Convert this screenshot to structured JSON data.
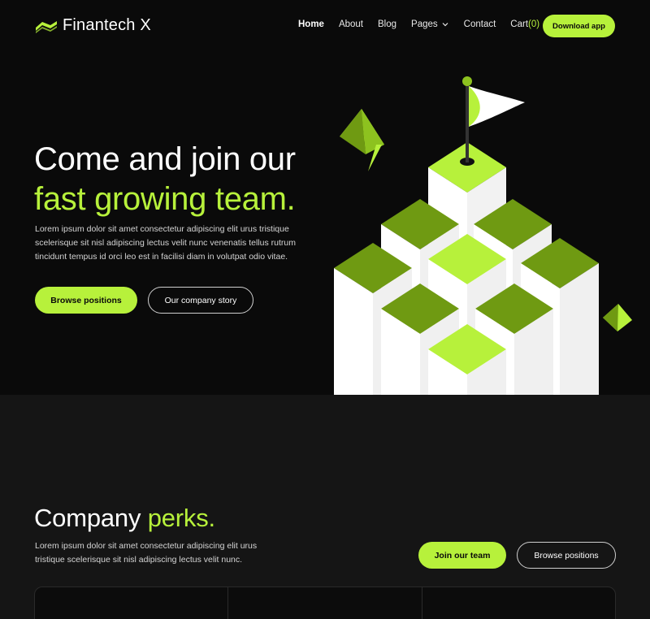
{
  "brand": {
    "name": "Finantech X",
    "accent_color": "#b7f13b",
    "dark_green": "#6f9a12",
    "background": "#0a0a0a"
  },
  "nav": {
    "items": [
      {
        "label": "Home",
        "active": true
      },
      {
        "label": "About"
      },
      {
        "label": "Blog"
      },
      {
        "label": "Pages",
        "has_dropdown": true
      },
      {
        "label": "Contact"
      }
    ],
    "cart_label": "Cart",
    "cart_count": "(0)",
    "download_label": "Download app"
  },
  "hero": {
    "title_line1": "Come and join our",
    "title_line2": "fast growing team.",
    "description": "Lorem ipsum dolor sit amet consectetur adipiscing elit urus tristique scelerisque sit nisl adipiscing lectus velit nunc venenatis tellus rutrum tincidunt tempus id orci leo est in facilisi diam in volutpat odio vitae.",
    "primary_button": "Browse positions",
    "secondary_button": "Our company story",
    "illustration": "isometric-bars-with-flag"
  },
  "perks": {
    "title_plain": "Company ",
    "title_accent": "perks.",
    "description": "Lorem ipsum dolor sit amet consectetur adipiscing elit urus tristique scelerisque sit nisl adipiscing lectus velit nunc.",
    "primary_button": "Join our team",
    "secondary_button": "Browse positions"
  }
}
